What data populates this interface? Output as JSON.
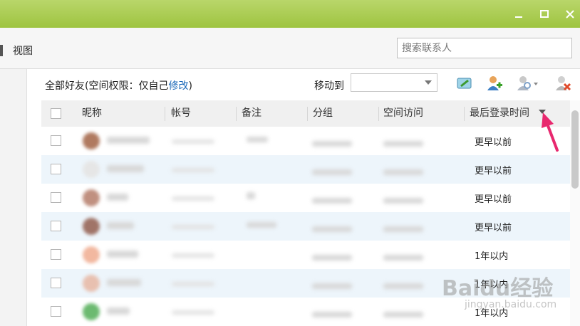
{
  "toolbar": {
    "view_label": "视图",
    "search_placeholder": "搜索联系人"
  },
  "group_bar": {
    "prefix": "全部好友(空间权限：仅自己",
    "link": "修改",
    "suffix": ")",
    "move_to_label": "移动到"
  },
  "table": {
    "columns": [
      "昵称",
      "帐号",
      "备注",
      "分组",
      "空间访问",
      "最后登录时间"
    ],
    "rows": [
      {
        "last_login": "更早以前"
      },
      {
        "last_login": "更早以前"
      },
      {
        "last_login": "更早以前"
      },
      {
        "last_login": "更早以前"
      },
      {
        "last_login": "1年以内"
      },
      {
        "last_login": "1年以内"
      },
      {
        "last_login": "1年以内"
      }
    ]
  },
  "colors": {
    "titlebar": "#a8cc52",
    "link": "#1a68b8",
    "arrow": "#e8286e",
    "row_alt": "#edf5fb"
  },
  "watermark": {
    "brand": "Baidu经验",
    "url": "jingyan.baidu.com"
  }
}
